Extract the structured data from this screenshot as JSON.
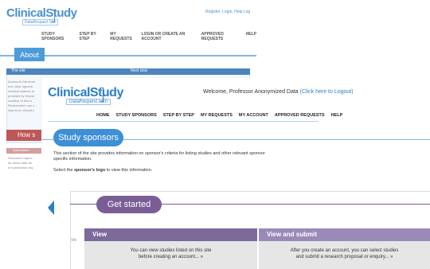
{
  "back": {
    "logo_main": "ClinicalStudy",
    "logo_sub": "DataRequest Site",
    "login_link": "Register, Login, Help Log",
    "nav": [
      "STUDY SPONSORS",
      "STEP BY STEP",
      "MY REQUESTS",
      "LOGIN OR CREATE AN ACCOUNT",
      "APPROVED REQUESTS",
      "HELP"
    ],
    "about_label": "About",
    "panel_head_left": "The site",
    "panel_head_right": "Next step",
    "about_text": [
      "Access to the anon",
      "one clear opportu",
      "medical science ar",
      "provided by resear",
      "creation of this si",
      "Researchers can u",
      "data from clinical s"
    ],
    "how_label": "How s",
    "submission_label": "Submission",
    "submission_text": [
      "Research reques",
      "for these data ne",
      "of submission req"
    ]
  },
  "front": {
    "logo_main": "ClinicalStudy",
    "logo_sub": "DataRequest.com",
    "welcome_text": "Welcome, Professor Anonymized Data",
    "logout_link": "(Click here to Logout)",
    "nav": [
      "HOME",
      "STUDY SPONSORS",
      "STEP BY STEP",
      "MY REQUESTS",
      "MY ACCOUNT",
      "APPROVED REQUESTS",
      "HELP"
    ],
    "sponsors_label": "Study sponsors",
    "intro_line1": "This section of the site provides information on sponsor's criteria for listing studies and other relevant sponsor",
    "intro_line2": "specific information.",
    "instr_prefix": "Select the ",
    "instr_bold": "sponsor's logo",
    "instr_suffix": " to view this information.",
    "get_started_label": "Get started",
    "side_text": "Vie",
    "view_head": "View",
    "view_line1": "You can view studies listed on this site",
    "view_line2": "before creating an account... »",
    "vs_head": "View and submit",
    "vs_line1": "After you create an account, you can select studies",
    "vs_line2": "and submit a research proposal or enquiry... »"
  },
  "colors": {
    "brand_blue": "#2c7fc7",
    "sponsor_tab": "#3d8fd6",
    "get_started_purple": "#7b5d96",
    "view_head": "#7d6a9b",
    "view_submit_head": "#9b8ab8",
    "how_red": "#b23b3b"
  },
  "icons": {
    "carousel_prev": "chevron-left-icon"
  }
}
